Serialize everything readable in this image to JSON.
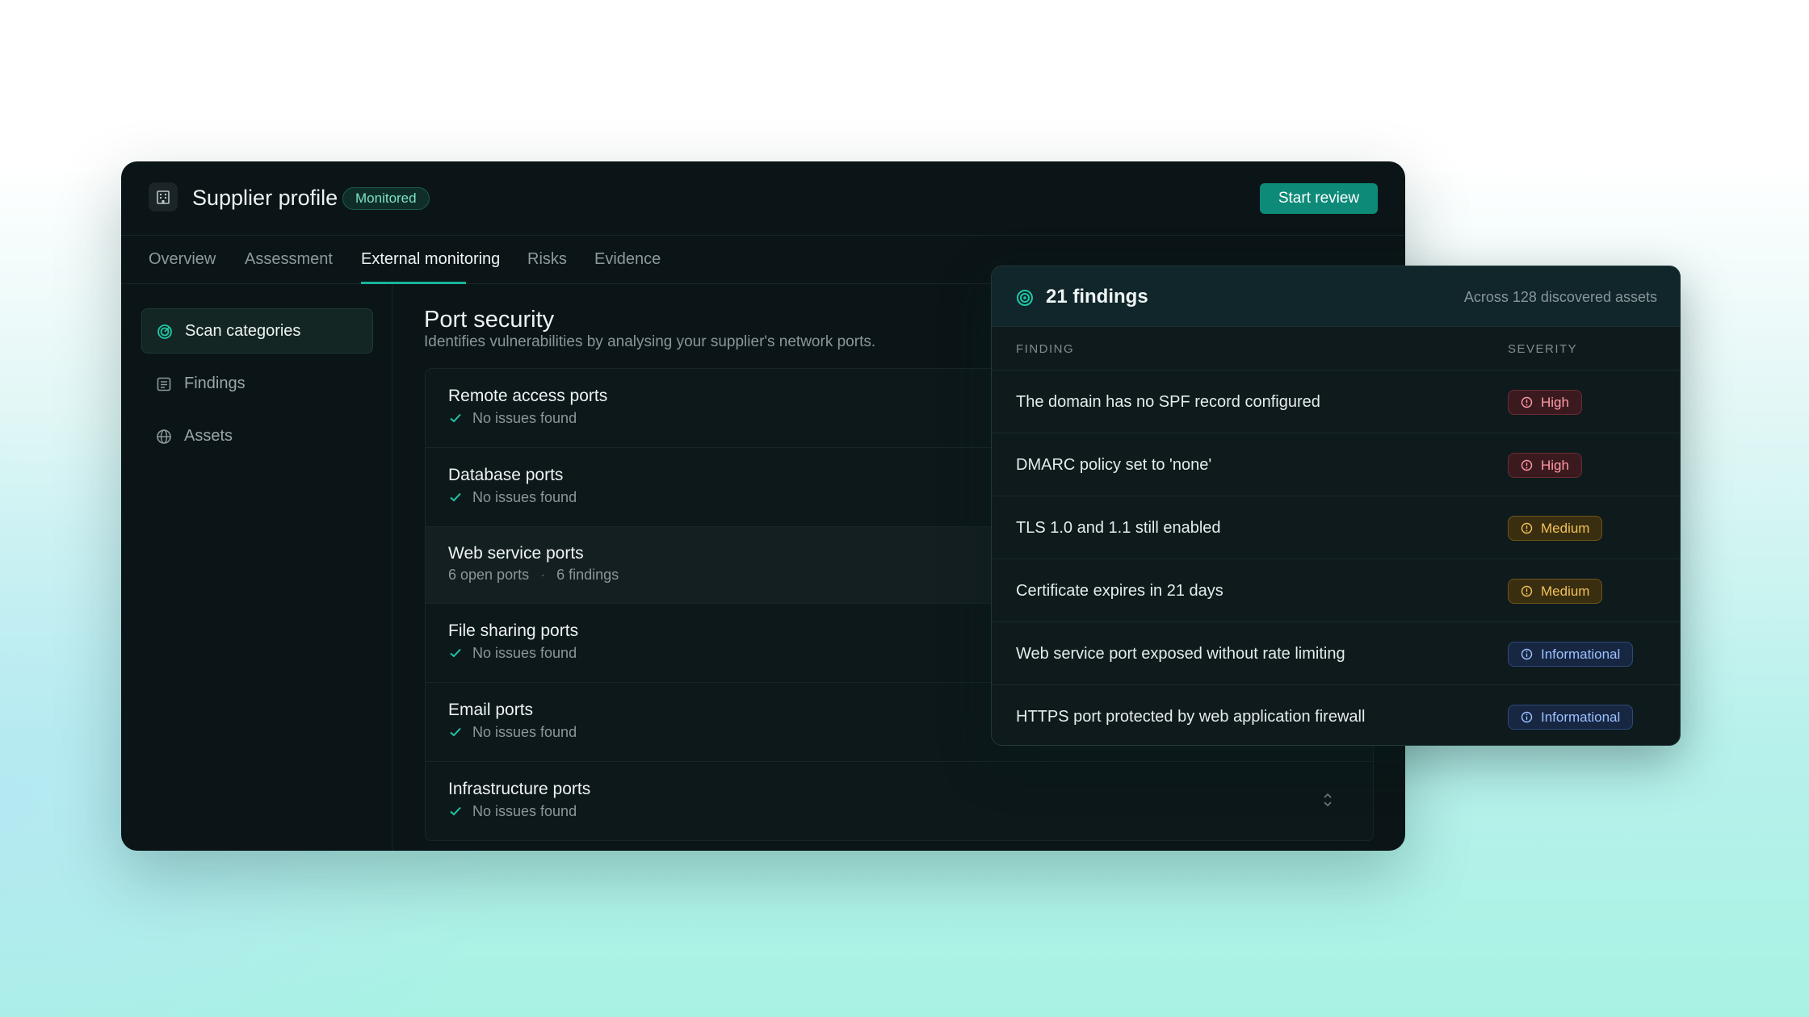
{
  "window": {
    "title": "Supplier profile",
    "status_badge": "Monitored",
    "primary_action": "Start review",
    "building_icon": "building-icon"
  },
  "tabs": [
    {
      "label": "Overview",
      "active": false
    },
    {
      "label": "Assessment",
      "active": false
    },
    {
      "label": "External monitoring",
      "active": true
    },
    {
      "label": "Risks",
      "active": false
    },
    {
      "label": "Evidence",
      "active": false
    }
  ],
  "sidebar": {
    "items": [
      {
        "label": "Scan categories",
        "icon": "radar-icon",
        "active": true
      },
      {
        "label": "Findings",
        "icon": "list-icon",
        "active": false
      },
      {
        "label": "Assets",
        "icon": "globe-icon",
        "active": false
      }
    ]
  },
  "content": {
    "title": "Port security",
    "subtitle": "Identifies vulnerabilities by analysing your supplier's network ports.",
    "ports": [
      {
        "name": "Remote access ports",
        "status": "No issues found"
      },
      {
        "name": "Database ports",
        "status": "No issues found"
      },
      {
        "name": "Web service ports",
        "open_ports": "6 open ports",
        "separator": "·",
        "findings": "6 findings"
      },
      {
        "name": "File sharing ports",
        "status": "No issues found"
      },
      {
        "name": "Email ports",
        "status": "No issues found"
      },
      {
        "name": "Infrastructure ports",
        "status": "No issues found"
      }
    ]
  },
  "findings_panel": {
    "title": "21 findings",
    "subtitle": "Across 128 discovered assets",
    "col_finding": "FINDING",
    "col_severity": "SEVERITY",
    "rows": [
      {
        "finding": "The domain has no SPF record configured",
        "severity": "High"
      },
      {
        "finding": "DMARC policy set to 'none'",
        "severity": "High"
      },
      {
        "finding": "TLS 1.0 and 1.1 still enabled",
        "severity": "Medium"
      },
      {
        "finding": "Certificate expires in 21 days",
        "severity": "Medium"
      },
      {
        "finding": "Web service port exposed without rate limiting",
        "severity": "Informational"
      },
      {
        "finding": "HTTPS port protected by web application firewall",
        "severity": "Informational"
      }
    ]
  },
  "colors": {
    "accent": "#0d8a78",
    "tab_underline": "#1bb39a",
    "window_bg": "#0b1517",
    "high": "#ff9aa5",
    "medium": "#f2c15a",
    "informational": "#9cc0ff"
  }
}
